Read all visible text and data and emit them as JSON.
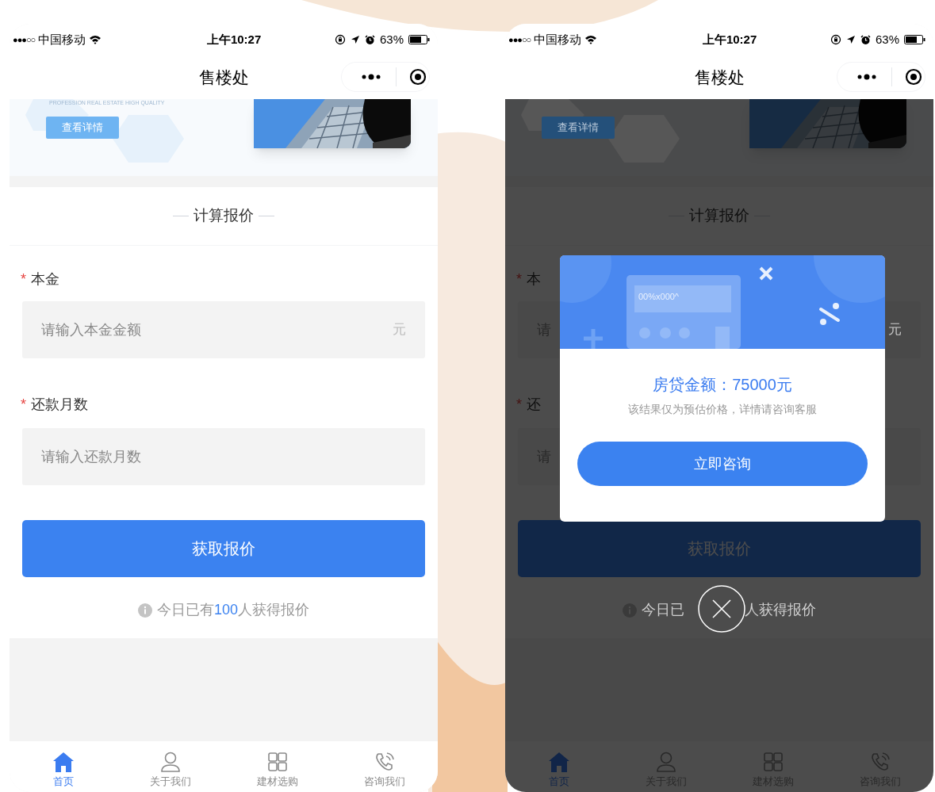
{
  "screens": [
    {
      "status_bar": {
        "signal": "●●●○○",
        "carrier": "中国移动",
        "time": "上午10:27",
        "battery": "63%"
      },
      "nav": {
        "title": "售楼处"
      },
      "banner": {
        "tagline": "PROFESSION REAL ESTATE HIGH QUALITY",
        "button": "查看详情"
      },
      "form": {
        "title": "计算报价",
        "fields": [
          {
            "mark": "*",
            "label": "本金",
            "placeholder": "请输入本金金额",
            "unit": "元"
          },
          {
            "mark": "*",
            "label": "还款月数",
            "placeholder": "请输入还款月数"
          }
        ],
        "submit": "获取报价",
        "hint_before": "今日已有",
        "hint_count": "100",
        "hint_after": "人获得报价"
      },
      "dimmed": false,
      "tabs": [
        {
          "label": "首页",
          "selected": true
        },
        {
          "label": "关于我们",
          "selected": false
        },
        {
          "label": "建材选购",
          "selected": false
        },
        {
          "label": "咨询我们",
          "selected": false
        }
      ]
    },
    {
      "status_bar": {
        "signal": "●●●○○",
        "carrier": "中国移动",
        "time": "上午10:27",
        "battery": "63%"
      },
      "nav": {
        "title": "售楼处"
      },
      "banner": {
        "button": "查看详情"
      },
      "form": {
        "title": "计算报价",
        "fields": [
          {
            "mark": "*",
            "label": "本",
            "placeholder": "请",
            "unit": "元"
          },
          {
            "mark": "*",
            "label": "还",
            "placeholder": "请"
          }
        ],
        "submit": "获取报价",
        "hint_before": "今日已",
        "hint_after": "人获得报价"
      },
      "dimmed": true,
      "dialog": {
        "display": "00%x000^",
        "amount": "房贷金额：75000元",
        "note": "该结果仅为预估价格，详情请咨询客服",
        "button": "立即咨询"
      },
      "tabs": [
        {
          "label": "首页",
          "selected": true
        },
        {
          "label": "关于我们",
          "selected": false
        },
        {
          "label": "建材选购",
          "selected": false
        },
        {
          "label": "咨询我们",
          "selected": false
        }
      ]
    }
  ]
}
